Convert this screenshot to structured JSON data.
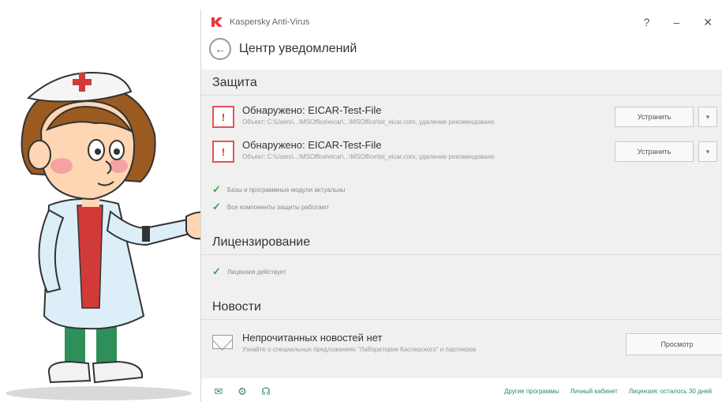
{
  "window": {
    "app_title": "Kaspersky Anti-Virus",
    "help_label": "?",
    "minimize_label": "–",
    "close_label": "✕"
  },
  "header": {
    "back_label": "←",
    "page_title": "Центр уведомлений"
  },
  "protection": {
    "title": "Защита",
    "threats": [
      {
        "title": "Обнаружено: EICAR-Test-File",
        "subtitle": "Объект: C:\\Users\\...\\MSOffice\\eicar\\...\\MSOffice\\tst_eicar.com, удаление рекомендовано",
        "fix_label": "Устранить",
        "dropdown_label": "▾"
      },
      {
        "title": "Обнаружено: EICAR-Test-File",
        "subtitle": "Объект: C:\\Users\\...\\MSOffice\\eicar\\...\\MSOffice\\tst_eicar.com, удаление рекомендовано",
        "fix_label": "Устранить",
        "dropdown_label": "▾"
      }
    ],
    "checks": [
      "Базы и программные модули актуальны",
      "Все компоненты защиты работают"
    ]
  },
  "licensing": {
    "title": "Лицензирование",
    "checks": [
      "Лицензия действует"
    ]
  },
  "news": {
    "title": "Новости",
    "item_title": "Непрочитанных новостей нет",
    "item_subtitle": "Узнайте о специальных предложениях \"Лаборатории Касперского\" и партнеров",
    "view_label": "Просмотр"
  },
  "footer": {
    "links": [
      "Другие программы",
      "Личный кабинет",
      "Лицензия: осталось 30 дней"
    ]
  },
  "colors": {
    "threat_red": "#e05555",
    "check_green": "#3aa24a",
    "link_green": "#2d8c5a"
  }
}
